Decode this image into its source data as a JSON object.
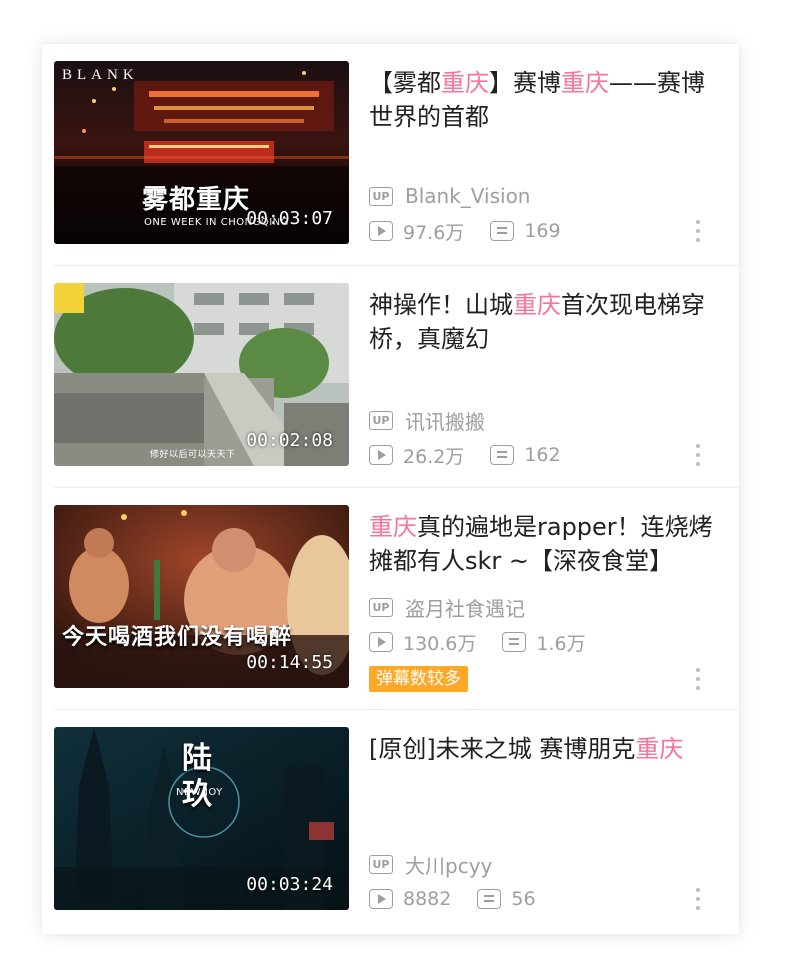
{
  "videos": [
    {
      "title_parts": [
        {
          "text": "【雾都",
          "hl": false
        },
        {
          "text": "重庆",
          "hl": true
        },
        {
          "text": "】赛博",
          "hl": false
        },
        {
          "text": "重庆",
          "hl": true
        },
        {
          "text": "——赛博世界的首都",
          "hl": false
        }
      ],
      "uploader": "Blank_Vision",
      "views": "97.6万",
      "danmaku": "169",
      "duration": "00:03:07",
      "thumb_logo": "BLANK",
      "thumb_caption": "雾都重庆",
      "thumb_sub": "ONE WEEK IN CHONGQING"
    },
    {
      "title_parts": [
        {
          "text": "神操作！山城",
          "hl": false
        },
        {
          "text": "重庆",
          "hl": true
        },
        {
          "text": "首次现电梯穿桥，真魔幻",
          "hl": false
        }
      ],
      "uploader": "讯讯搬搬",
      "views": "26.2万",
      "danmaku": "162",
      "duration": "00:02:08",
      "thumb_sub": "修好以后可以天天下"
    },
    {
      "title_parts": [
        {
          "text": "重庆",
          "hl": true
        },
        {
          "text": "真的遍地是rapper！连烧烤摊都有人skr ~【深夜食堂】",
          "hl": false
        }
      ],
      "uploader": "盗月社食遇记",
      "views": "130.6万",
      "danmaku": "1.6万",
      "duration": "00:14:55",
      "badge": "弹幕数较多",
      "thumb_caption": "今天喝酒我们没有喝醉"
    },
    {
      "title_parts": [
        {
          "text": "[原创]未来之城 赛博朋克",
          "hl": false
        },
        {
          "text": "重庆",
          "hl": true
        }
      ],
      "uploader": "大川pcyy",
      "views": "8882",
      "danmaku": "56",
      "duration": "00:03:24",
      "thumb_caption": "陆 玖",
      "thumb_sub": "NEW JOY"
    }
  ],
  "labels": {
    "up_badge": "UP"
  },
  "colors": {
    "highlight": "#fb7299",
    "badge": "#ffa726",
    "meta": "#9e9e9e"
  },
  "icons": {
    "views": "play-icon",
    "danmaku": "danmaku-icon",
    "more": "more-vertical-icon"
  }
}
